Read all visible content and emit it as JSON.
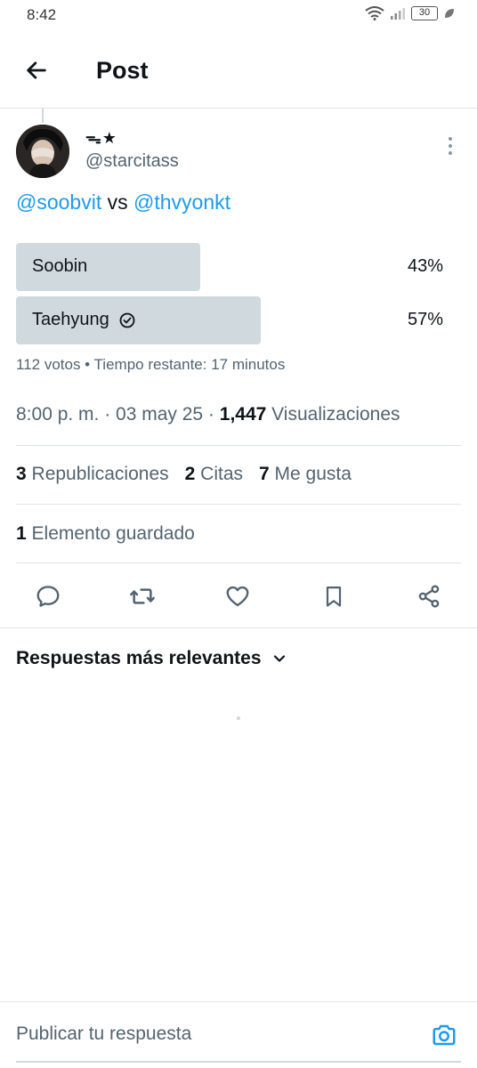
{
  "status_bar": {
    "time": "8:42",
    "battery": "30"
  },
  "header": {
    "title": "Post"
  },
  "author": {
    "display_name": "ᯓ★",
    "handle": "@starcitass"
  },
  "post": {
    "mention_1": "@soobvit",
    "connector": " vs ",
    "mention_2": "@thvyonkt"
  },
  "poll": {
    "options": [
      {
        "label": "Soobin",
        "percent": "43%",
        "fill": 0.43,
        "selected": false
      },
      {
        "label": "Taehyung",
        "percent": "57%",
        "fill": 0.57,
        "selected": true
      }
    ],
    "meta": "112 votos • Tiempo restante: 17 minutos"
  },
  "timestamp": {
    "time_date": "8:00 p. m. · 03 may 25 · ",
    "views_count": "1,447",
    "views_label": " Visualizaciones"
  },
  "stats": {
    "reposts_count": "3",
    "reposts_label": " Republicaciones",
    "quotes_count": "2",
    "quotes_label": " Citas",
    "likes_count": "7",
    "likes_label": " Me gusta"
  },
  "saved": {
    "count": "1",
    "label": " Elemento guardado"
  },
  "actions": [
    "reply-icon",
    "repost-icon",
    "like-icon",
    "bookmark-icon",
    "share-icon"
  ],
  "replies": {
    "sort_label": "Respuestas más relevantes"
  },
  "composer": {
    "placeholder": "Publicar tu respuesta"
  },
  "colors": {
    "accent": "#1d9bf0",
    "poll_fill": "#cfd9de",
    "secondary_text": "#536471"
  }
}
